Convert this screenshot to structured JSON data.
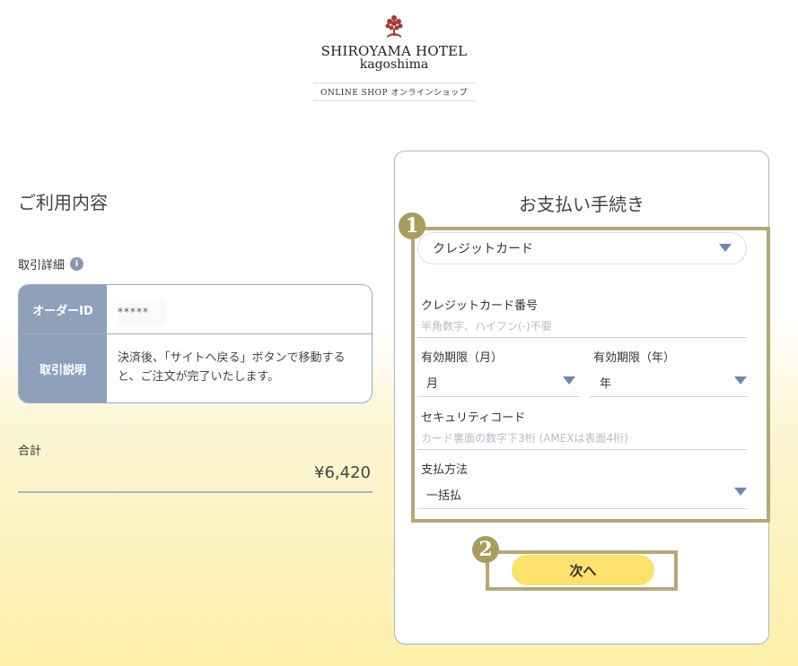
{
  "logo": {
    "name": "SHIROYAMA HOTEL",
    "sub": "kagoshima",
    "shop": "ONLINE SHOP  オンラインショップ"
  },
  "usage": {
    "title": "ご利用内容",
    "detail_label": "取引詳細",
    "info_icon": "i",
    "order_id_label": "オーダーID",
    "order_id_value": "*****",
    "description_label": "取引説明",
    "description_value": "決済後、「サイトへ戻る」ボタンで移動すると、ご注文が完了いたします。",
    "total_label": "合計",
    "total_value": "¥6,420"
  },
  "payment": {
    "title": "お支払い手続き",
    "method_selected": "クレジットカード",
    "card_number_label": "クレジットカード番号",
    "card_number_placeholder": "半角数字、ハイフン(-)不要",
    "expiry_month_label": "有効期限（月）",
    "expiry_month_value": "月",
    "expiry_year_label": "有効期限（年）",
    "expiry_year_value": "年",
    "security_label": "セキュリティコード",
    "security_placeholder": "カード裏面の数字下3桁 (AMEXは表面4桁)",
    "pay_method_label": "支払方法",
    "pay_method_value": "一括払",
    "next_button": "次へ"
  },
  "annotations": {
    "badge1": "1",
    "badge2": "2"
  },
  "colors": {
    "accent_button": "#fde26e",
    "table_header": "#8fa0bb",
    "highlight": "#b3a979"
  }
}
